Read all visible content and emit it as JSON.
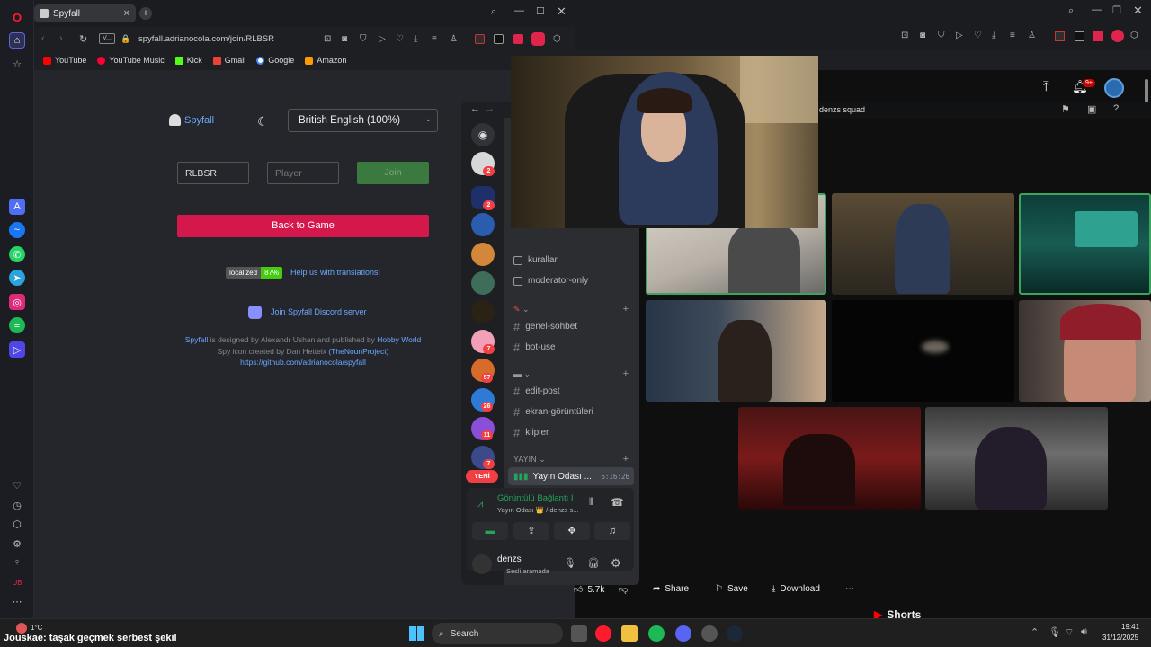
{
  "left_browser": {
    "tab_title": "Spyfall",
    "url": "spyfall.adrianocola.com/join/RLBSR",
    "bookmarks": [
      "YouTube",
      "YouTube Music",
      "Kick",
      "Gmail",
      "Google",
      "Amazon"
    ]
  },
  "spyfall": {
    "logo": "Spyfall",
    "language": "British English (100%)",
    "room_code": "RLBSR",
    "player_placeholder": "Player",
    "join_label": "Join",
    "back_label": "Back to Game",
    "localized_label": "localized",
    "localized_pct": "87%",
    "help_link": "Help us with translations!",
    "discord_link": "Join Spyfall Discord server",
    "credit_line1_pre": "Spyfall",
    "credit_line1_mid": " is designed by Alexandr Ushan and published by ",
    "credit_line1_link": "Hobby World",
    "credit_line2_pre": "Spy icon created by Dan Hetteix ",
    "credit_line2_link": "(TheNounProject)",
    "credit_line3": "https://github.com/adrianocola/spyfall"
  },
  "discord": {
    "channels": [
      {
        "name": "kurallar",
        "kind": "rules"
      },
      {
        "name": "moderator-only",
        "kind": "rules"
      }
    ],
    "text_channels": [
      "genel-sohbet",
      "bot-use"
    ],
    "media_channels": [
      "edit-post",
      "ekran-görüntüleri",
      "klipler"
    ],
    "voice_category": "YAYIN",
    "voice_channel": "Yayın Odası ...",
    "voice_timer": "6:16:26",
    "new_badge": "YENİ",
    "connection_status": "Görüntülü Bağlantı I",
    "connection_sub": "Yayın Odası 👑 / denzs s...",
    "username": "denzs",
    "user_status": "Sesli aramada",
    "badges": [
      "2",
      "2",
      "7",
      "57",
      "26",
      "11",
      "7"
    ]
  },
  "right_panel": {
    "server_title": "denzs squad",
    "notif_count": "9+",
    "likes": "5.7k",
    "share_label": "Share",
    "save_label": "Save",
    "download_label": "Download",
    "shorts_label": "Shorts"
  },
  "taskbar": {
    "weather_temp": "1°C",
    "ticker": "Jouskae: taşak geçmek serbest şekil",
    "search_label": "Search",
    "time": "19:41",
    "date": "31/12/2025"
  },
  "colors": {
    "join_green": "#3d8b40",
    "back_red": "#d4184b",
    "discord_blurple": "#5865f2",
    "tile_border": "#3ba55d"
  }
}
